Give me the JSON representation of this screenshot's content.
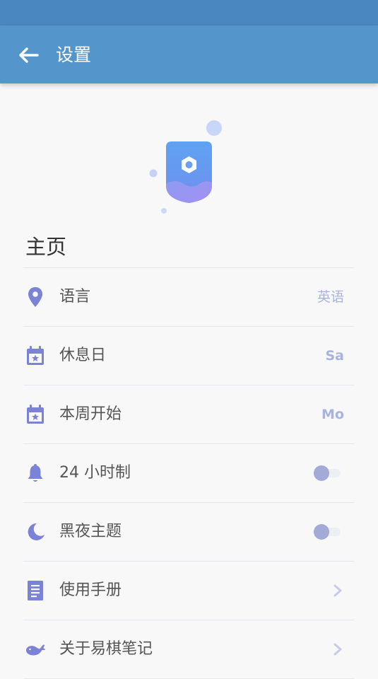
{
  "app_bar": {
    "title": "设置",
    "back_icon": "arrow-left-icon"
  },
  "section": {
    "title": "主页"
  },
  "colors": {
    "status_bar": "#4a86bf",
    "app_bar": "#5496cc",
    "accent": "#7b83d6",
    "value_text": "#a7b3e0",
    "divider": "#e5e7f2"
  },
  "settings": [
    {
      "label": "语言",
      "icon": "map-pin-icon",
      "value": "英语"
    },
    {
      "label": "休息日",
      "icon": "calendar-star-icon",
      "value": "Sa"
    },
    {
      "label": "本周开始",
      "icon": "calendar-star-icon",
      "value": "Mo"
    },
    {
      "label": "24 小时制",
      "icon": "bell-icon",
      "toggle_on": false
    },
    {
      "label": "黑夜主题",
      "icon": "moon-icon",
      "toggle_on": false
    },
    {
      "label": "使用手册",
      "icon": "document-icon"
    },
    {
      "label": "关于易棋笔记",
      "icon": "whale-icon"
    }
  ]
}
